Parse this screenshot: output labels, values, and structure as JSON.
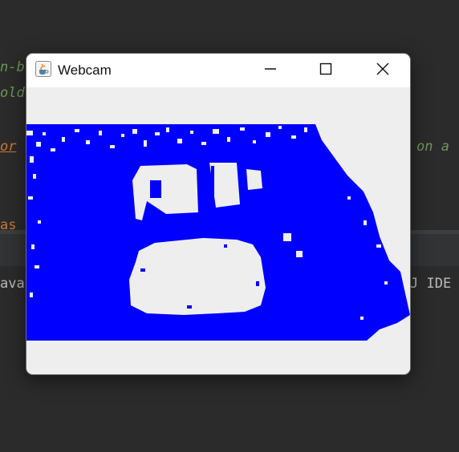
{
  "ide_background": {
    "fragments": [
      "n-b",
      "old",
      "or",
      "on a",
      "as",
      "ava",
      "J IDE"
    ]
  },
  "window": {
    "title": "Webcam",
    "app_icon": "java-cup-icon",
    "controls": {
      "minimize": "minimize-icon",
      "maximize": "maximize-icon",
      "close": "close-icon"
    }
  },
  "webcam_frame": {
    "description_colors": {
      "foreground": "#0000ff",
      "background": "#eeeeee"
    }
  }
}
